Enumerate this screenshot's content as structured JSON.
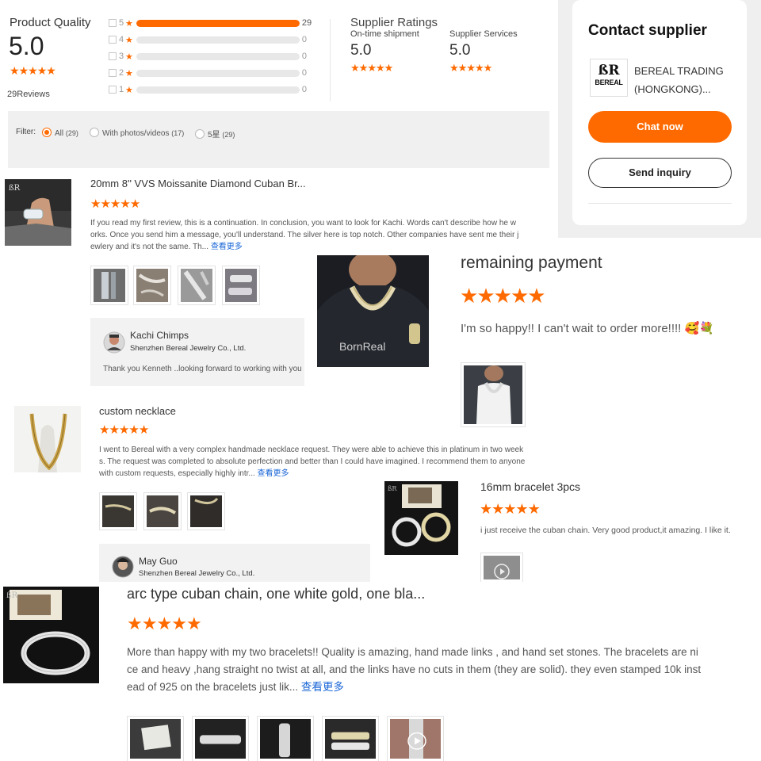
{
  "summary": {
    "product_quality_label": "Product Quality",
    "product_quality_score": "5.0",
    "reviews_count": "29",
    "reviews_label": "Reviews",
    "stars_rating": 5,
    "breakdown": [
      {
        "star": "5",
        "count": "29",
        "fraction": 1.0
      },
      {
        "star": "4",
        "count": "0",
        "fraction": 0
      },
      {
        "star": "3",
        "count": "0",
        "fraction": 0
      },
      {
        "star": "2",
        "count": "0",
        "fraction": 0
      },
      {
        "star": "1",
        "count": "0",
        "fraction": 0
      }
    ],
    "supplier_ratings_label": "Supplier Ratings",
    "ontime_label": "On-time shipment",
    "ontime_score": "5.0",
    "services_label": "Supplier Services",
    "services_score": "5.0"
  },
  "filter": {
    "label": "Filter:",
    "options": [
      {
        "label": "All",
        "count": "(29)",
        "selected": true
      },
      {
        "label": "With photos/videos",
        "count": "(17)",
        "selected": false
      },
      {
        "label": "5星",
        "count": "(29)",
        "selected": false
      }
    ]
  },
  "contact": {
    "title": "Contact supplier",
    "logo_text": "BEREAL",
    "logo_monogram": "ßR",
    "company_line1": "BEREAL TRADING",
    "company_line2": "(HONGKONG)...",
    "chat_label": "Chat now",
    "inquiry_label": "Send inquiry"
  },
  "reviews": {
    "r1": {
      "title": "20mm 8'' VVS Moissanite Diamond Cuban Br...",
      "text1": "If you read my first review, this is a continuation. In conclusion, you want to look for Kachi. Words can't describe how he w",
      "text2": "orks. Once you send him a message, you'll understand. The silver here is top notch. Other companies have sent me their j",
      "text3": "ewlery and it's not the same. Th...",
      "more": "查看更多",
      "reply_name": "Kachi Chimps",
      "reply_company": "Shenzhen Bereal Jewelry Co., Ltd.",
      "reply_text": "Thank you Kenneth ..looking forward to working with you"
    },
    "r2": {
      "title": "remaining payment",
      "text": "I'm so happy!! I can't wait to order more!!!!",
      "emoji1": "🥰",
      "emoji2": "💐",
      "photo_caption": "BornReal"
    },
    "r3": {
      "title": "custom necklace",
      "text1": "I went to Bereal with a very complex handmade necklace request. They were able to achieve this in platinum in two week",
      "text2": "s. The request was completed to absolute perfection and better than I could have imagined. I recommend them to anyone",
      "text3": "with custom requests, especially highly intr...",
      "more": "查看更多",
      "reply_name": "May Guo",
      "reply_company": "Shenzhen Bereal Jewelry Co., Ltd."
    },
    "r4": {
      "title": "16mm bracelet 3pcs",
      "text": "i just receive the cuban chain. Very good product,it amazing. I like it."
    },
    "r5": {
      "title": "arc type cuban chain, one white gold, one bla...",
      "text1": "More than happy  with my two bracelets!! Quality is amazing, hand made links , and hand set stones. The bracelets are ni",
      "text2": "ce and heavy ,hang straight no twist at all, and the links have no cuts in them (they are solid). they even stamped 10k inst",
      "text3": "ead of 925 on the bracelets just lik...",
      "more": "查看更多"
    }
  },
  "colors": {
    "accent": "#ff6a00",
    "link": "#1a66d6",
    "filter_bg": "#f0f0f0"
  }
}
